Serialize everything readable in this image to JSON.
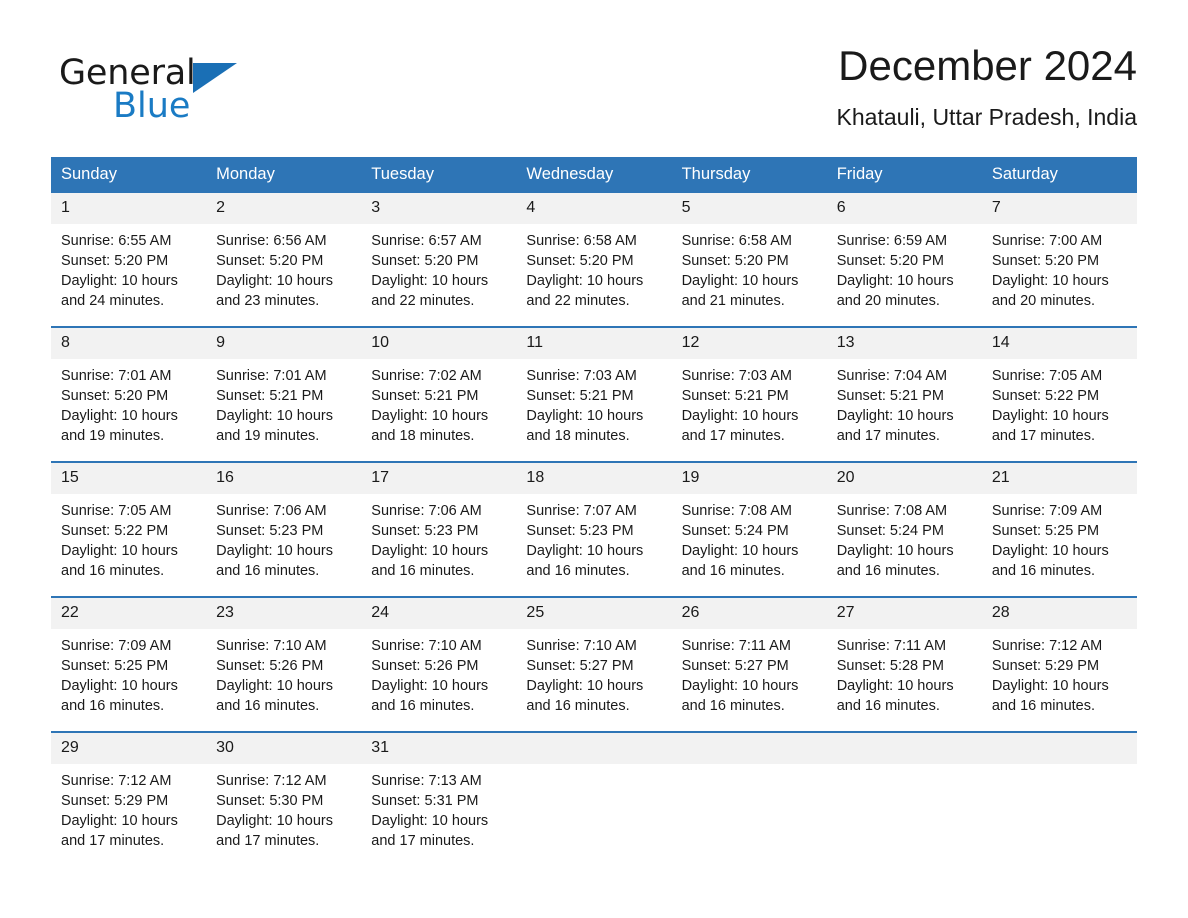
{
  "brand": {
    "name_part1": "General",
    "name_part2": "Blue",
    "triangle_color": "#1a6fb5",
    "blue_color": "#1a7bc4"
  },
  "header": {
    "title": "December 2024",
    "location": "Khatauli, Uttar Pradesh, India"
  },
  "theme": {
    "header_blue": "#2e75b6",
    "row_divider_blue": "#2e75b6",
    "daynum_band": "#f2f2f2",
    "text": "#1a1a1a"
  },
  "weekdays": [
    "Sunday",
    "Monday",
    "Tuesday",
    "Wednesday",
    "Thursday",
    "Friday",
    "Saturday"
  ],
  "weeks": [
    [
      {
        "day": "1",
        "sunrise": "Sunrise: 6:55 AM",
        "sunset": "Sunset: 5:20 PM",
        "daylight": "Daylight: 10 hours and 24 minutes."
      },
      {
        "day": "2",
        "sunrise": "Sunrise: 6:56 AM",
        "sunset": "Sunset: 5:20 PM",
        "daylight": "Daylight: 10 hours and 23 minutes."
      },
      {
        "day": "3",
        "sunrise": "Sunrise: 6:57 AM",
        "sunset": "Sunset: 5:20 PM",
        "daylight": "Daylight: 10 hours and 22 minutes."
      },
      {
        "day": "4",
        "sunrise": "Sunrise: 6:58 AM",
        "sunset": "Sunset: 5:20 PM",
        "daylight": "Daylight: 10 hours and 22 minutes."
      },
      {
        "day": "5",
        "sunrise": "Sunrise: 6:58 AM",
        "sunset": "Sunset: 5:20 PM",
        "daylight": "Daylight: 10 hours and 21 minutes."
      },
      {
        "day": "6",
        "sunrise": "Sunrise: 6:59 AM",
        "sunset": "Sunset: 5:20 PM",
        "daylight": "Daylight: 10 hours and 20 minutes."
      },
      {
        "day": "7",
        "sunrise": "Sunrise: 7:00 AM",
        "sunset": "Sunset: 5:20 PM",
        "daylight": "Daylight: 10 hours and 20 minutes."
      }
    ],
    [
      {
        "day": "8",
        "sunrise": "Sunrise: 7:01 AM",
        "sunset": "Sunset: 5:20 PM",
        "daylight": "Daylight: 10 hours and 19 minutes."
      },
      {
        "day": "9",
        "sunrise": "Sunrise: 7:01 AM",
        "sunset": "Sunset: 5:21 PM",
        "daylight": "Daylight: 10 hours and 19 minutes."
      },
      {
        "day": "10",
        "sunrise": "Sunrise: 7:02 AM",
        "sunset": "Sunset: 5:21 PM",
        "daylight": "Daylight: 10 hours and 18 minutes."
      },
      {
        "day": "11",
        "sunrise": "Sunrise: 7:03 AM",
        "sunset": "Sunset: 5:21 PM",
        "daylight": "Daylight: 10 hours and 18 minutes."
      },
      {
        "day": "12",
        "sunrise": "Sunrise: 7:03 AM",
        "sunset": "Sunset: 5:21 PM",
        "daylight": "Daylight: 10 hours and 17 minutes."
      },
      {
        "day": "13",
        "sunrise": "Sunrise: 7:04 AM",
        "sunset": "Sunset: 5:21 PM",
        "daylight": "Daylight: 10 hours and 17 minutes."
      },
      {
        "day": "14",
        "sunrise": "Sunrise: 7:05 AM",
        "sunset": "Sunset: 5:22 PM",
        "daylight": "Daylight: 10 hours and 17 minutes."
      }
    ],
    [
      {
        "day": "15",
        "sunrise": "Sunrise: 7:05 AM",
        "sunset": "Sunset: 5:22 PM",
        "daylight": "Daylight: 10 hours and 16 minutes."
      },
      {
        "day": "16",
        "sunrise": "Sunrise: 7:06 AM",
        "sunset": "Sunset: 5:23 PM",
        "daylight": "Daylight: 10 hours and 16 minutes."
      },
      {
        "day": "17",
        "sunrise": "Sunrise: 7:06 AM",
        "sunset": "Sunset: 5:23 PM",
        "daylight": "Daylight: 10 hours and 16 minutes."
      },
      {
        "day": "18",
        "sunrise": "Sunrise: 7:07 AM",
        "sunset": "Sunset: 5:23 PM",
        "daylight": "Daylight: 10 hours and 16 minutes."
      },
      {
        "day": "19",
        "sunrise": "Sunrise: 7:08 AM",
        "sunset": "Sunset: 5:24 PM",
        "daylight": "Daylight: 10 hours and 16 minutes."
      },
      {
        "day": "20",
        "sunrise": "Sunrise: 7:08 AM",
        "sunset": "Sunset: 5:24 PM",
        "daylight": "Daylight: 10 hours and 16 minutes."
      },
      {
        "day": "21",
        "sunrise": "Sunrise: 7:09 AM",
        "sunset": "Sunset: 5:25 PM",
        "daylight": "Daylight: 10 hours and 16 minutes."
      }
    ],
    [
      {
        "day": "22",
        "sunrise": "Sunrise: 7:09 AM",
        "sunset": "Sunset: 5:25 PM",
        "daylight": "Daylight: 10 hours and 16 minutes."
      },
      {
        "day": "23",
        "sunrise": "Sunrise: 7:10 AM",
        "sunset": "Sunset: 5:26 PM",
        "daylight": "Daylight: 10 hours and 16 minutes."
      },
      {
        "day": "24",
        "sunrise": "Sunrise: 7:10 AM",
        "sunset": "Sunset: 5:26 PM",
        "daylight": "Daylight: 10 hours and 16 minutes."
      },
      {
        "day": "25",
        "sunrise": "Sunrise: 7:10 AM",
        "sunset": "Sunset: 5:27 PM",
        "daylight": "Daylight: 10 hours and 16 minutes."
      },
      {
        "day": "26",
        "sunrise": "Sunrise: 7:11 AM",
        "sunset": "Sunset: 5:27 PM",
        "daylight": "Daylight: 10 hours and 16 minutes."
      },
      {
        "day": "27",
        "sunrise": "Sunrise: 7:11 AM",
        "sunset": "Sunset: 5:28 PM",
        "daylight": "Daylight: 10 hours and 16 minutes."
      },
      {
        "day": "28",
        "sunrise": "Sunrise: 7:12 AM",
        "sunset": "Sunset: 5:29 PM",
        "daylight": "Daylight: 10 hours and 16 minutes."
      }
    ],
    [
      {
        "day": "29",
        "sunrise": "Sunrise: 7:12 AM",
        "sunset": "Sunset: 5:29 PM",
        "daylight": "Daylight: 10 hours and 17 minutes."
      },
      {
        "day": "30",
        "sunrise": "Sunrise: 7:12 AM",
        "sunset": "Sunset: 5:30 PM",
        "daylight": "Daylight: 10 hours and 17 minutes."
      },
      {
        "day": "31",
        "sunrise": "Sunrise: 7:13 AM",
        "sunset": "Sunset: 5:31 PM",
        "daylight": "Daylight: 10 hours and 17 minutes."
      },
      {
        "day": "",
        "sunrise": "",
        "sunset": "",
        "daylight": ""
      },
      {
        "day": "",
        "sunrise": "",
        "sunset": "",
        "daylight": ""
      },
      {
        "day": "",
        "sunrise": "",
        "sunset": "",
        "daylight": ""
      },
      {
        "day": "",
        "sunrise": "",
        "sunset": "",
        "daylight": ""
      }
    ]
  ]
}
